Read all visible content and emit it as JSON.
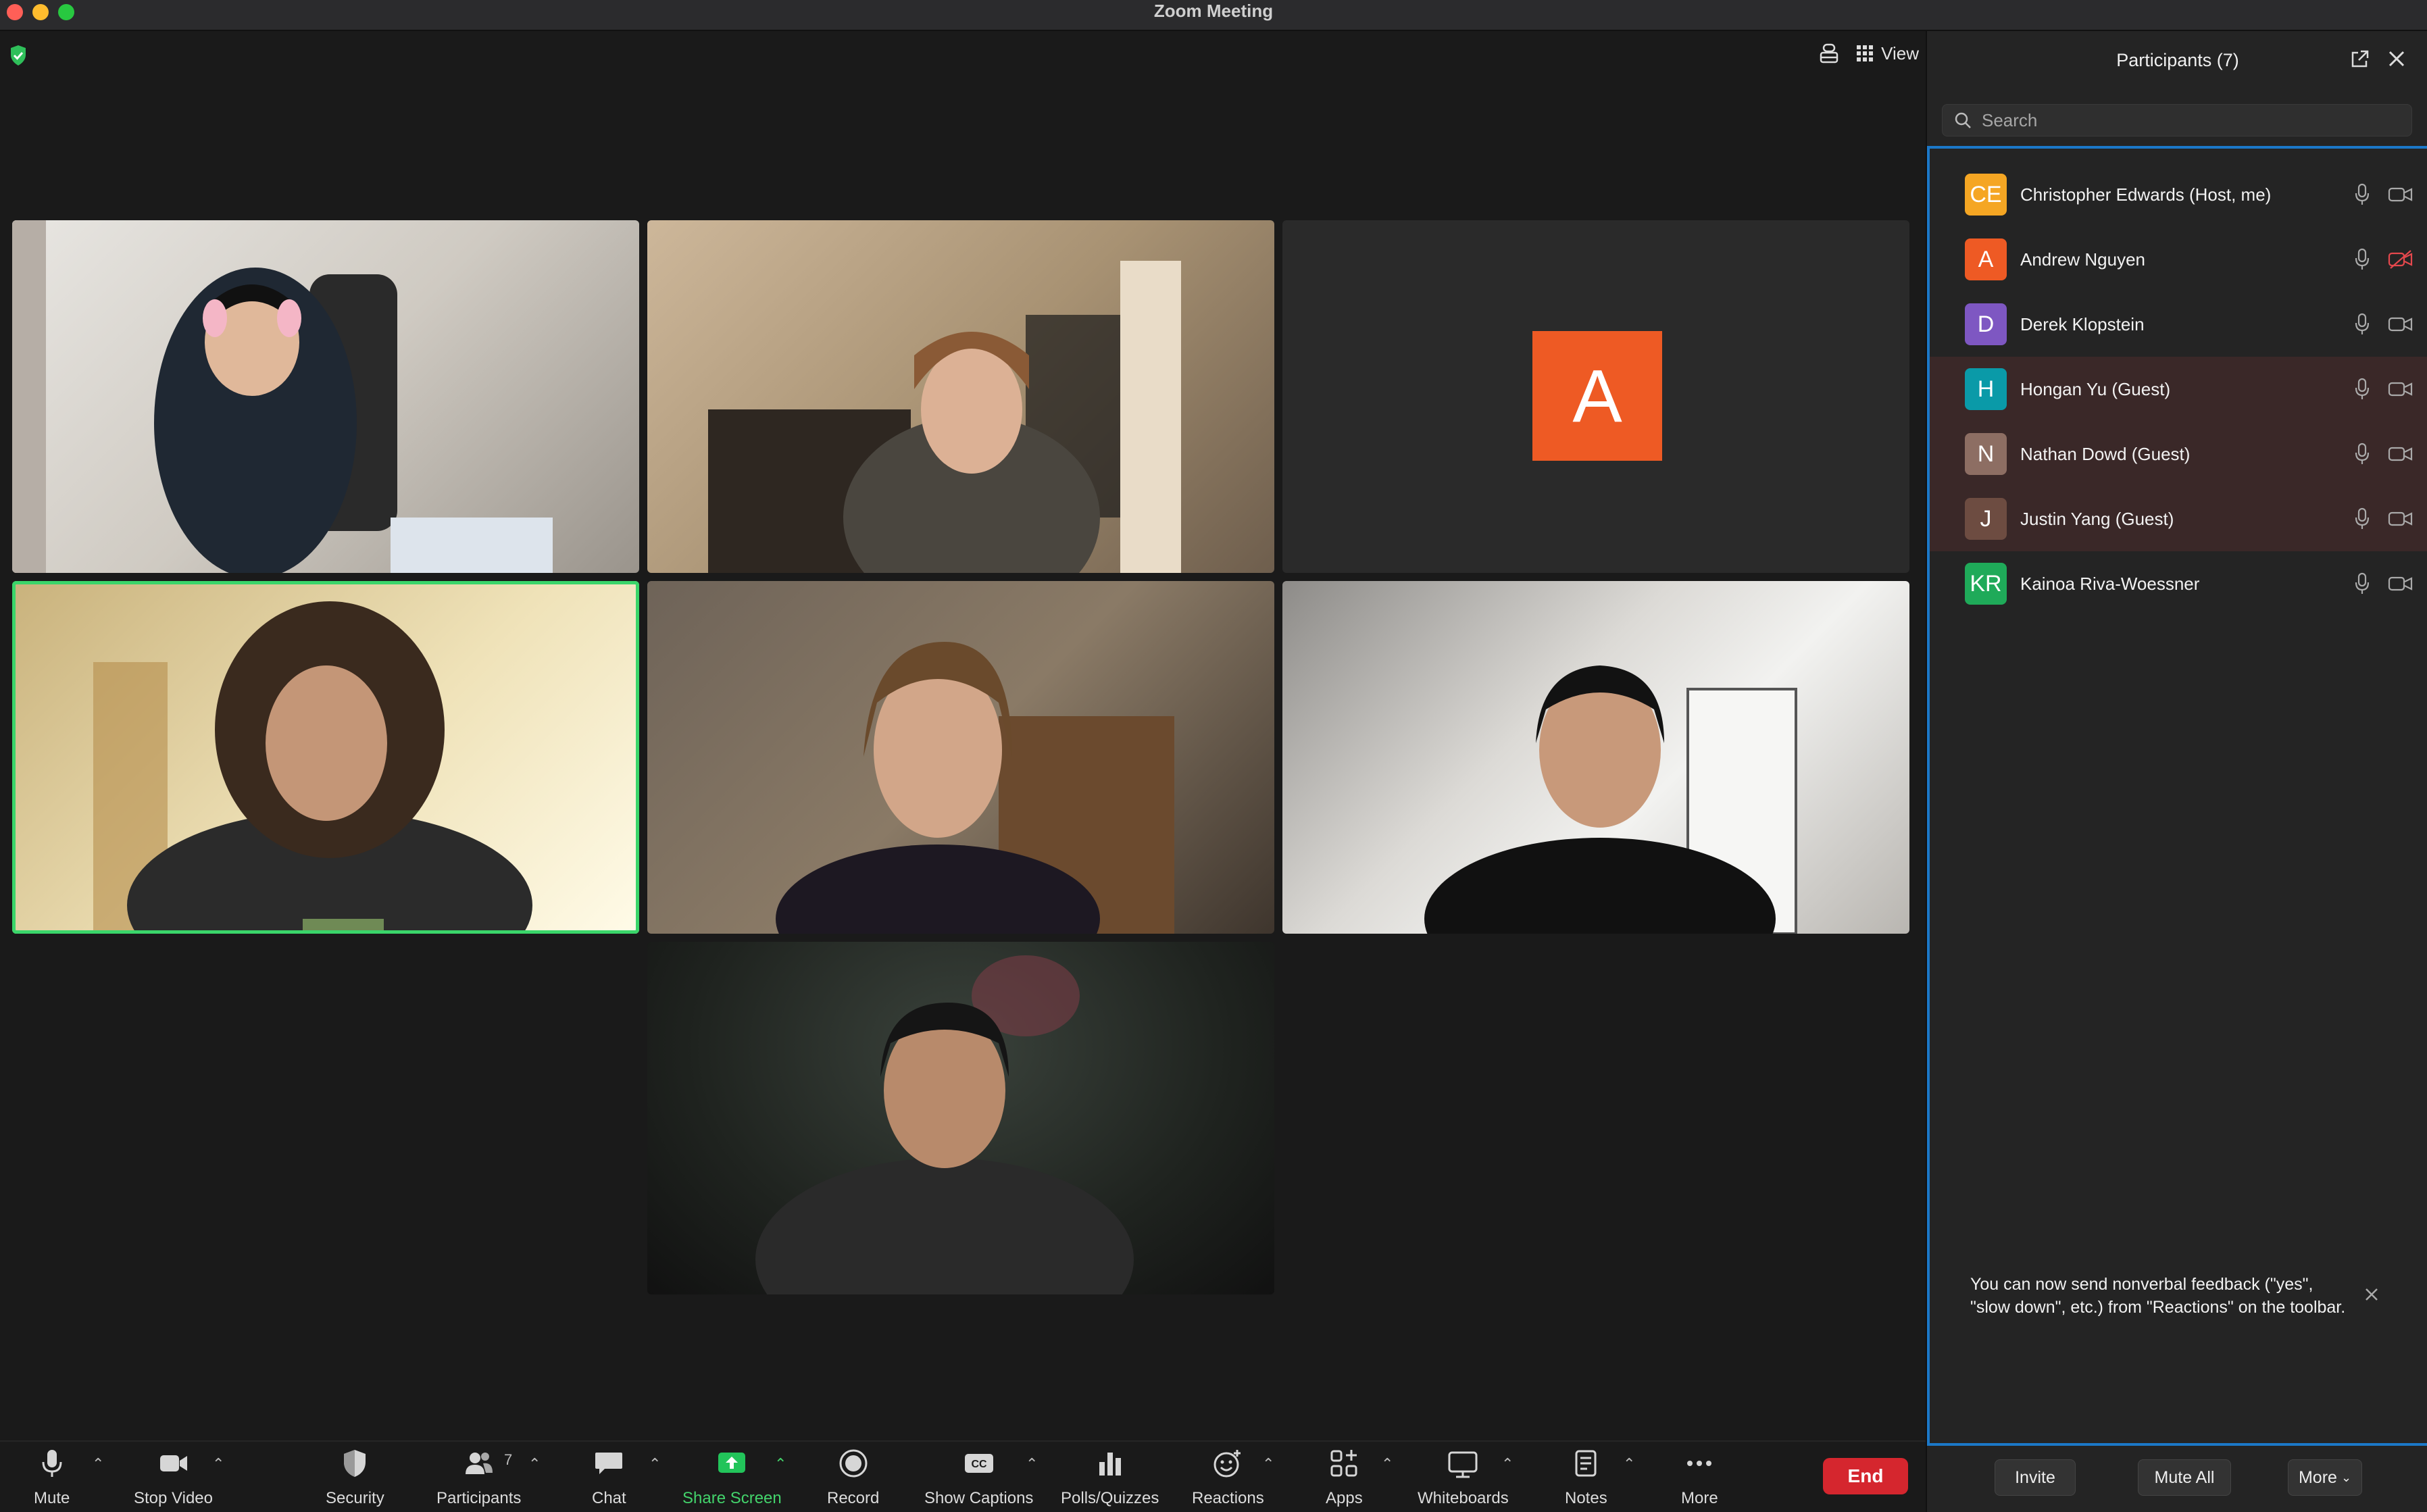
{
  "window": {
    "title": "Zoom Meeting"
  },
  "stage": {
    "view_label": "View",
    "avatar_tile_initial": "A",
    "avatar_tile_color": "#ee5a24",
    "active_speaker_color": "#3ad56a"
  },
  "toolbar": {
    "mute": "Mute",
    "stop_video": "Stop Video",
    "security": "Security",
    "participants": "Participants",
    "participants_count": "7",
    "chat": "Chat",
    "share_screen": "Share Screen",
    "record": "Record",
    "show_captions": "Show Captions",
    "polls": "Polls/Quizzes",
    "reactions": "Reactions",
    "apps": "Apps",
    "whiteboards": "Whiteboards",
    "notes": "Notes",
    "more": "More",
    "end": "End"
  },
  "panel": {
    "title": "Participants (7)",
    "search_placeholder": "Search",
    "participants": [
      {
        "initials": "CE",
        "name": "Christopher Edwards (Host, me)",
        "color": "#f5a623",
        "guest": false,
        "camera_off": false
      },
      {
        "initials": "A",
        "name": "Andrew Nguyen",
        "color": "#ee5a24",
        "guest": false,
        "camera_off": true
      },
      {
        "initials": "D",
        "name": "Derek Klopstein",
        "color": "#7e57c2",
        "guest": false,
        "camera_off": false
      },
      {
        "initials": "H",
        "name": "Hongan Yu (Guest)",
        "color": "#0a9aa8",
        "guest": true,
        "camera_off": false
      },
      {
        "initials": "N",
        "name": "Nathan Dowd (Guest)",
        "color": "#8d6e63",
        "guest": true,
        "camera_off": false
      },
      {
        "initials": "J",
        "name": "Justin Yang (Guest)",
        "color": "#6d4c41",
        "guest": true,
        "camera_off": false
      },
      {
        "initials": "KR",
        "name": "Kainoa Riva-Woessner",
        "color": "#1faa59",
        "guest": false,
        "camera_off": false
      }
    ],
    "notice": "You can now send nonverbal feedback (\"yes\", \"slow down\", etc.) from \"Reactions\" on the toolbar.",
    "invite": "Invite",
    "mute_all": "Mute All",
    "more": "More"
  }
}
